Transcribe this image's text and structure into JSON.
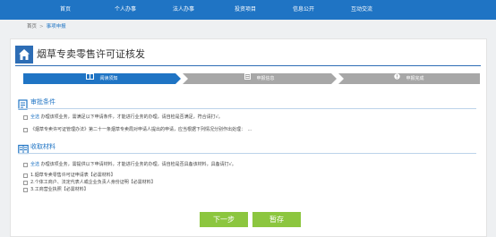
{
  "nav": {
    "items": [
      "首页",
      "个人办事",
      "法人办事",
      "投资项目",
      "信息公开",
      "互动交流"
    ]
  },
  "breadcrumb": {
    "home": "首页",
    "separator": ">",
    "current": "事项申报"
  },
  "page": {
    "title": "烟草专卖零售许可证核发"
  },
  "steps": [
    {
      "label": "阅读须知",
      "icon": "book-icon",
      "state": "active"
    },
    {
      "label": "申报信息",
      "icon": "form-icon",
      "state": "inactive"
    },
    {
      "label": "申报完成",
      "icon": "info-icon",
      "state": "inactive"
    }
  ],
  "conditions": {
    "title": "审批条件",
    "items": [
      {
        "prefix": "全选",
        "text": " 办理该项业务，需满足以下申请条件，才能进行业务的办理，请自检是否满足，符合请打√。"
      },
      {
        "prefix": "",
        "text": "《烟草专卖许可证管理办法》第二十一条烟草专卖局对申请人提出的申请，应当根据下列情况分别作出处理：　..."
      }
    ]
  },
  "materials": {
    "title": "收取材料",
    "select_all": {
      "prefix": "全选",
      "text": " 办理该项业务，需提供以下申请材料，才能进行业务的办理，请自检是否具备该材料，具备请打√。"
    },
    "items": [
      "1.烟草专卖零售许可证申请表【必需材料】",
      "2.个体工商户、法定代表人或企业负责人身份证明【必需材料】",
      "3.工商营业执照【必需材料】"
    ]
  },
  "buttons": {
    "next": "下一步",
    "save": "暂存"
  },
  "colors": {
    "primary": "#1f74c4",
    "inactive_step": "#a7a7a7",
    "button": "#8cc63f"
  }
}
